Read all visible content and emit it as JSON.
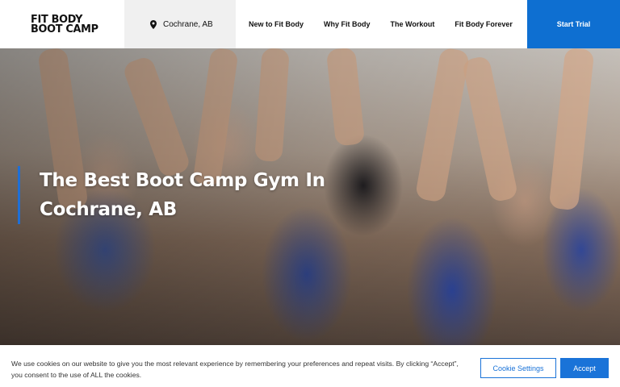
{
  "header": {
    "logo_line1": "FIT BODY",
    "logo_line2": "BOOT CAMP",
    "location": "Cochrane, AB",
    "nav": [
      {
        "label": "New to Fit Body"
      },
      {
        "label": "Why Fit Body"
      },
      {
        "label": "The Workout"
      },
      {
        "label": "Fit Body Forever"
      }
    ],
    "cta_label": "Start Trial"
  },
  "hero": {
    "title": "The Best Boot Camp Gym In Cochrane, AB"
  },
  "cookie": {
    "text": "We use cookies on our website to give you the most relevant experience by remembering your preferences and repeat visits. By clicking “Accept”, you consent to the use of ALL the cookies.",
    "settings_label": "Cookie Settings",
    "accept_label": "Accept"
  },
  "colors": {
    "accent": "#0e6fd1",
    "hero_bar": "#1f6fd6"
  }
}
